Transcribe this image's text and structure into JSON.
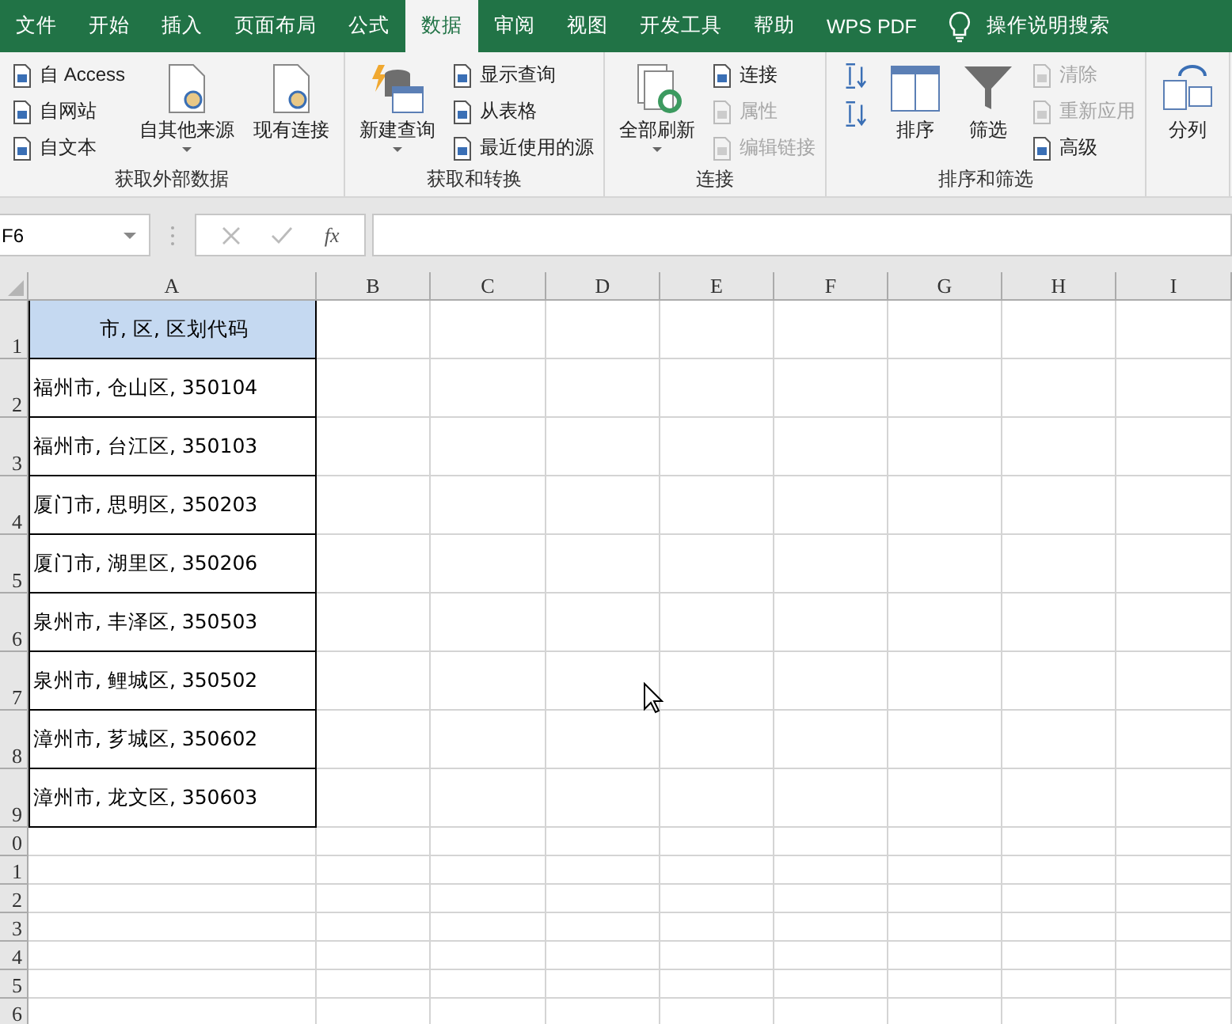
{
  "tabs": [
    {
      "label": "文件",
      "selected": false
    },
    {
      "label": "开始",
      "selected": false
    },
    {
      "label": "插入",
      "selected": false
    },
    {
      "label": "页面布局",
      "selected": false
    },
    {
      "label": "公式",
      "selected": false
    },
    {
      "label": "数据",
      "selected": true
    },
    {
      "label": "审阅",
      "selected": false
    },
    {
      "label": "视图",
      "selected": false
    },
    {
      "label": "开发工具",
      "selected": false
    },
    {
      "label": "帮助",
      "selected": false
    },
    {
      "label": "WPS PDF",
      "selected": false
    }
  ],
  "tell_me": {
    "label": "操作说明搜索"
  },
  "ribbon": {
    "groups": [
      {
        "label": "获取外部数据",
        "columns": [
          [
            {
              "label": "自 Access",
              "kind": "small",
              "disabled": false,
              "dropdown": false
            },
            {
              "label": "自网站",
              "kind": "small",
              "disabled": false,
              "dropdown": false
            },
            {
              "label": "自文本",
              "kind": "small",
              "disabled": false,
              "dropdown": false
            }
          ],
          [
            {
              "label": "自其他来源",
              "kind": "large",
              "disabled": false,
              "dropdown": true
            }
          ],
          [
            {
              "label": "现有连接",
              "kind": "large",
              "disabled": false,
              "dropdown": false
            }
          ]
        ]
      },
      {
        "label": "获取和转换",
        "columns": [
          [
            {
              "label": "新建查询",
              "kind": "large",
              "disabled": false,
              "dropdown": true
            }
          ],
          [
            {
              "label": "显示查询",
              "kind": "small",
              "disabled": false,
              "dropdown": false
            },
            {
              "label": "从表格",
              "kind": "small",
              "disabled": false,
              "dropdown": false
            },
            {
              "label": "最近使用的源",
              "kind": "small",
              "disabled": false,
              "dropdown": false
            }
          ]
        ]
      },
      {
        "label": "连接",
        "columns": [
          [
            {
              "label": "全部刷新",
              "kind": "large",
              "disabled": false,
              "dropdown": true
            }
          ],
          [
            {
              "label": "连接",
              "kind": "small",
              "disabled": false,
              "dropdown": false
            },
            {
              "label": "属性",
              "kind": "small",
              "disabled": true,
              "dropdown": false
            },
            {
              "label": "编辑链接",
              "kind": "small",
              "disabled": true,
              "dropdown": false
            }
          ]
        ]
      },
      {
        "label": "排序和筛选",
        "columns": [
          [
            {
              "kind": "icon",
              "disabled": false
            },
            {
              "kind": "icon",
              "disabled": false
            }
          ],
          [
            {
              "label": "排序",
              "kind": "large",
              "disabled": false,
              "dropdown": false
            }
          ],
          [
            {
              "label": "筛选",
              "kind": "large",
              "disabled": false,
              "dropdown": false
            }
          ],
          [
            {
              "label": "清除",
              "kind": "small",
              "disabled": true,
              "dropdown": false
            },
            {
              "label": "重新应用",
              "kind": "small",
              "disabled": true,
              "dropdown": false
            },
            {
              "label": "高级",
              "kind": "small",
              "disabled": false,
              "dropdown": false
            }
          ]
        ]
      },
      {
        "columns": [
          [
            {
              "label": "分列",
              "kind": "large",
              "disabled": false,
              "dropdown": false
            }
          ]
        ]
      }
    ]
  },
  "formula_bar": {
    "name_box": "F6",
    "function_label": "fx"
  },
  "sheet": {
    "columns": [
      "A",
      "B",
      "C",
      "D",
      "E",
      "F",
      "G",
      "H",
      "I"
    ],
    "rows": [
      {
        "header": "1",
        "kind": "tall",
        "cells": [
          {
            "text": "市, 区, 区划代码",
            "highlighted": true
          }
        ]
      },
      {
        "header": "2",
        "kind": "tall",
        "cells": [
          {
            "text": "福州市, 仓山区, 350104",
            "highlighted": false
          }
        ]
      },
      {
        "header": "3",
        "kind": "tall",
        "cells": [
          {
            "text": "福州市, 台江区, 350103",
            "highlighted": false
          }
        ]
      },
      {
        "header": "4",
        "kind": "tall",
        "cells": [
          {
            "text": "厦门市, 思明区, 350203",
            "highlighted": false
          }
        ]
      },
      {
        "header": "5",
        "kind": "tall",
        "cells": [
          {
            "text": "厦门市, 湖里区, 350206",
            "highlighted": false
          }
        ]
      },
      {
        "header": "6",
        "kind": "tall",
        "cells": [
          {
            "text": "泉州市, 丰泽区, 350503",
            "highlighted": false
          }
        ]
      },
      {
        "header": "7",
        "kind": "tall",
        "cells": [
          {
            "text": "泉州市, 鲤城区, 350502",
            "highlighted": false
          }
        ]
      },
      {
        "header": "8",
        "kind": "tall",
        "cells": [
          {
            "text": "漳州市, 芗城区, 350602",
            "highlighted": false
          }
        ]
      },
      {
        "header": "9",
        "kind": "tall",
        "cells": [
          {
            "text": "漳州市, 龙文区, 350603",
            "highlighted": false
          }
        ]
      },
      {
        "header": "0",
        "kind": "short",
        "cells": []
      },
      {
        "header": "1",
        "kind": "short",
        "cells": []
      },
      {
        "header": "2",
        "kind": "short",
        "cells": []
      },
      {
        "header": "3",
        "kind": "short",
        "cells": []
      },
      {
        "header": "4",
        "kind": "short",
        "cells": []
      },
      {
        "header": "5",
        "kind": "short",
        "cells": []
      },
      {
        "header": "6",
        "kind": "short",
        "cells": []
      }
    ]
  }
}
